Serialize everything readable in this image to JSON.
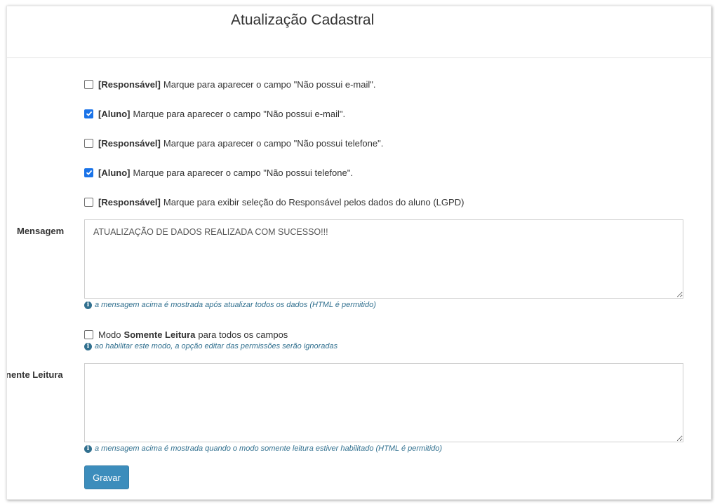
{
  "header": {
    "title": "Atualização Cadastral"
  },
  "options": [
    {
      "checked": false,
      "tag": "[Responsável]",
      "text": "Marque para aparecer o campo \"Não possui e-mail\"."
    },
    {
      "checked": true,
      "tag": "[Aluno]",
      "text": "Marque para aparecer o campo \"Não possui e-mail\"."
    },
    {
      "checked": false,
      "tag": "[Responsável]",
      "text": "Marque para aparecer o campo \"Não possui telefone\"."
    },
    {
      "checked": true,
      "tag": "[Aluno]",
      "text": "Marque para aparecer o campo \"Não possui telefone\"."
    },
    {
      "checked": false,
      "tag": "[Responsável]",
      "text": "Marque para exibir seleção do Responsável pelos dados do aluno (LGPD)"
    }
  ],
  "mensagem": {
    "label": "Mensagem",
    "value": "ATUALIZAÇÃO DE DADOS REALIZADA COM SUCESSO!!!",
    "help": "a mensagem acima é mostrada após atualizar todos os dados (HTML é permitido)"
  },
  "readonly_mode": {
    "checked": false,
    "prefix": "Modo",
    "bold": "Somente Leitura",
    "suffix": "para todos os campos",
    "help": "ao habilitar este modo, a opção editar das permissões serão ignoradas"
  },
  "readonly_message": {
    "label": "nente Leitura",
    "value": "",
    "help": "a mensagem acima é mostrada quando o modo somente leitura estiver habilitado (HTML é permitido)"
  },
  "save_button": {
    "label": "Gravar"
  },
  "colors": {
    "accent": "#3c8dbc",
    "checkbox_checked": "#1a73e8",
    "help_text": "#31708f"
  }
}
